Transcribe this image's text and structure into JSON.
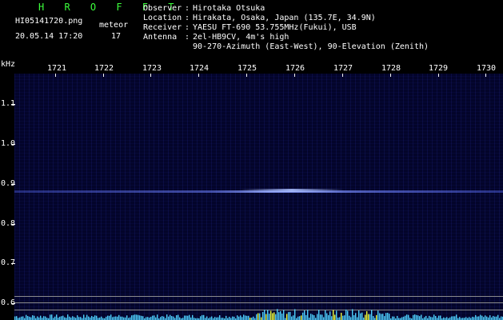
{
  "app": {
    "title": "H R O F F T",
    "file_name": "HI05141720.png",
    "type_label": "meteor",
    "timestamp": "20.05.14 17:20",
    "count": "17"
  },
  "info": [
    {
      "key": "Observer",
      "value": "Hirotaka Otsuka"
    },
    {
      "key": "Location",
      "value": "Hirakata, Osaka, Japan (135.7E, 34.9N)"
    },
    {
      "key": "Receiver",
      "value": "YAESU FT-690 53.755MHz(Fukui), USB"
    },
    {
      "key": "Antenna",
      "value": "2el-HB9CV, 4m's high"
    },
    {
      "key": "",
      "value": "90-270-Azimuth (East-West), 90-Elevation (Zenith)"
    }
  ],
  "spectrogram": {
    "y_unit": "kHz",
    "x_ticks": [
      "1721",
      "1722",
      "1723",
      "1724",
      "1725",
      "1726",
      "1727",
      "1728",
      "1729",
      "1730"
    ],
    "y_ticks": [
      "1.1",
      "1.0",
      "0.9",
      "0.8",
      "0.7",
      "0.6"
    ],
    "colors": {
      "background": "#03042a",
      "echo": "#8aa0ff",
      "noise": "#4fd0ff",
      "brand": "#3cff3c"
    }
  }
}
